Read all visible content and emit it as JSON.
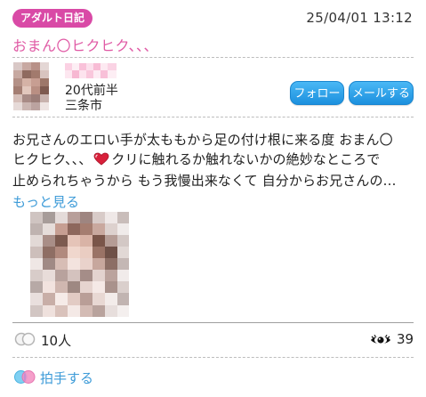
{
  "header": {
    "tag_label": "アダルト日記",
    "datetime": "25/04/01 13:12"
  },
  "post": {
    "title": "おまん〇ヒクヒク、、、",
    "author": {
      "age": "20代前半",
      "city": "三条市"
    },
    "actions": {
      "follow_label": "フォロー",
      "mail_label": "メールする"
    },
    "body_lines": {
      "line1": "お兄さんのエロい手が太ももから足の付け根に来る度 おまん〇",
      "line2a": "ヒクヒク、、、",
      "line2b": "クリに触れるか触れないかの絶妙なところで",
      "line3": "止められちゃうから もう我慢出来なくて 自分からお兄さんの…"
    },
    "more_label": "もっと見る",
    "stats": {
      "claps_count": "10人",
      "views_count": "39"
    },
    "clap_action_label": "拍手する"
  },
  "colors": {
    "accent_pink": "#e05aa5",
    "tag_bg": "#d94aa6",
    "button_blue": "#1c90de",
    "link_blue": "#3d9bd8"
  },
  "icons": [
    "heart-icon",
    "clap-hands-icon",
    "eye-icon"
  ]
}
